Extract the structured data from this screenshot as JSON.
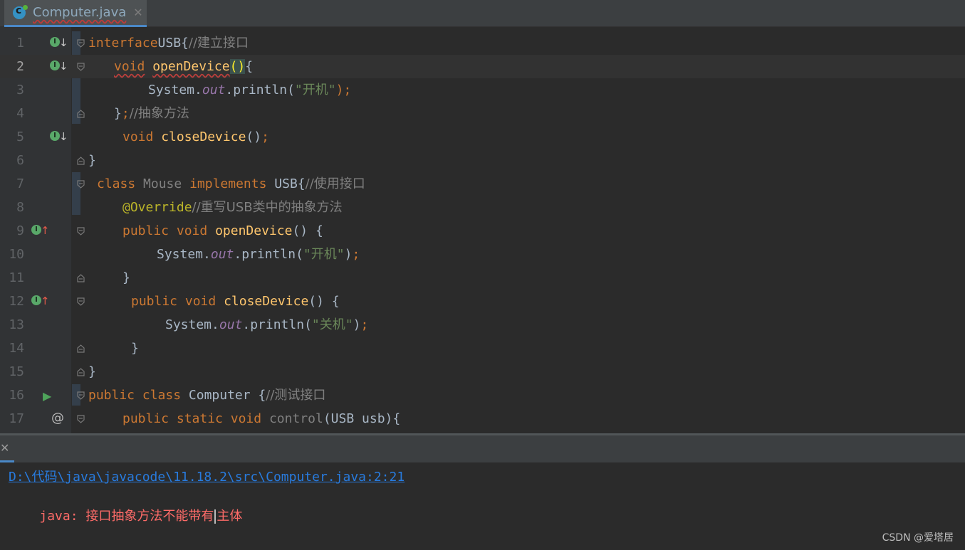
{
  "tab": {
    "filename": "Computer.java",
    "close_glyph": "✕"
  },
  "lines": [
    {
      "n": "1",
      "gutter": "impl-down",
      "fold": "open",
      "indent": 0,
      "tokens": [
        [
          "kw",
          "interface"
        ],
        [
          "",
          "USB{"
        ],
        [
          "cm",
          "//建立接口"
        ]
      ]
    },
    {
      "n": "2",
      "gutter": "impl-down",
      "fold": "open",
      "indent": 3,
      "current": true,
      "tokens": [
        [
          "kw squig",
          "void"
        ],
        [
          "",
          "·"
        ],
        [
          "fn squig",
          "openDevice"
        ],
        [
          "brk",
          "()"
        ],
        [
          "",
          "{"
        ]
      ]
    },
    {
      "n": "3",
      "gutter": "",
      "fold": "",
      "indent": 7,
      "tokens": [
        [
          "",
          "System."
        ],
        [
          "fld",
          "out"
        ],
        [
          "",
          ".println("
        ],
        [
          "str",
          "\"开机\""
        ],
        [
          "kw",
          ")"
        ],
        [
          "kw",
          ";"
        ]
      ]
    },
    {
      "n": "4",
      "gutter": "",
      "fold": "close",
      "indent": 3,
      "tokens": [
        [
          "",
          "}"
        ],
        [
          "kw",
          ";"
        ],
        [
          "cm",
          "//抽象方法"
        ]
      ]
    },
    {
      "n": "5",
      "gutter": "impl-down",
      "fold": "",
      "indent": 4,
      "tokens": [
        [
          "kw",
          "void"
        ],
        [
          "",
          ""
        ],
        [
          "fn",
          "closeDevice"
        ],
        [
          "",
          "()"
        ],
        [
          "kw",
          ";"
        ]
      ]
    },
    {
      "n": "6",
      "gutter": "",
      "fold": "close",
      "indent": 0,
      "tokens": [
        [
          "",
          "}"
        ]
      ]
    },
    {
      "n": "7",
      "gutter": "",
      "fold": "open",
      "indent": 1,
      "tokens": [
        [
          "kw",
          "class"
        ],
        [
          "",
          ""
        ],
        [
          "gray",
          "Mouse"
        ],
        [
          "",
          ""
        ],
        [
          "kw",
          "implements"
        ],
        [
          "",
          ""
        ],
        [
          "",
          "USB{"
        ],
        [
          "cm",
          "//使用接口"
        ]
      ]
    },
    {
      "n": "8",
      "gutter": "",
      "fold": "",
      "indent": 4,
      "tokens": [
        [
          "ann",
          "@Override"
        ],
        [
          "cm",
          "//重写USB类中的抽象方法"
        ]
      ]
    },
    {
      "n": "9",
      "gutter": "impl-up",
      "fold": "open",
      "indent": 4,
      "tokens": [
        [
          "kw",
          "public"
        ],
        [
          "",
          ""
        ],
        [
          "kw",
          "void"
        ],
        [
          "",
          ""
        ],
        [
          "fn",
          "openDevice"
        ],
        [
          "",
          "()"
        ],
        [
          "",
          ""
        ],
        [
          "",
          "{"
        ]
      ]
    },
    {
      "n": "10",
      "gutter": "",
      "fold": "",
      "indent": 8,
      "tokens": [
        [
          "",
          "System."
        ],
        [
          "fld",
          "out"
        ],
        [
          "",
          ".println("
        ],
        [
          "str",
          "\"开机\""
        ],
        [
          "",
          ")"
        ],
        [
          "kw",
          ";"
        ]
      ]
    },
    {
      "n": "11",
      "gutter": "",
      "fold": "close",
      "indent": 4,
      "tokens": [
        [
          "",
          "}"
        ]
      ]
    },
    {
      "n": "12",
      "gutter": "impl-up",
      "fold": "open",
      "indent": 5,
      "tokens": [
        [
          "kw",
          "public"
        ],
        [
          "",
          ""
        ],
        [
          "kw",
          "void"
        ],
        [
          "",
          ""
        ],
        [
          "fn",
          "closeDevice"
        ],
        [
          "",
          "()"
        ],
        [
          "",
          ""
        ],
        [
          "",
          "{"
        ]
      ]
    },
    {
      "n": "13",
      "gutter": "",
      "fold": "",
      "indent": 9,
      "tokens": [
        [
          "",
          "System."
        ],
        [
          "fld",
          "out"
        ],
        [
          "",
          ".println("
        ],
        [
          "str",
          "\"关机\""
        ],
        [
          "",
          ")"
        ],
        [
          "kw",
          ";"
        ]
      ]
    },
    {
      "n": "14",
      "gutter": "",
      "fold": "close",
      "indent": 5,
      "tokens": [
        [
          "",
          "}"
        ]
      ]
    },
    {
      "n": "15",
      "gutter": "",
      "fold": "close",
      "indent": 0,
      "tokens": [
        [
          "",
          "}"
        ]
      ]
    },
    {
      "n": "16",
      "gutter": "run",
      "fold": "open",
      "indent": 0,
      "tokens": [
        [
          "kw",
          "public"
        ],
        [
          "",
          ""
        ],
        [
          "kw",
          "class"
        ],
        [
          "",
          ""
        ],
        [
          "",
          "Computer"
        ],
        [
          "",
          ""
        ],
        [
          "",
          "{"
        ],
        [
          "cm",
          "//测试接口"
        ]
      ]
    },
    {
      "n": "17",
      "gutter": "at",
      "fold": "open",
      "indent": 4,
      "tokens": [
        [
          "kw",
          "public"
        ],
        [
          "",
          ""
        ],
        [
          "kw",
          "static"
        ],
        [
          "",
          ""
        ],
        [
          "kw",
          "void"
        ],
        [
          "",
          ""
        ],
        [
          "gray",
          "control"
        ],
        [
          "",
          "(USB"
        ],
        [
          "",
          ""
        ],
        [
          "",
          "usb){"
        ]
      ]
    }
  ],
  "output": {
    "path": "D:\\代码\\java\\javacode\\11.18.2\\src\\Computer.java:2:21",
    "label": "java:",
    "message_before_caret": "接口抽象方法不能带有",
    "message_after_caret": "主体"
  },
  "watermark": "CSDN @爱塔居",
  "colors": {
    "keyword": "#cc7832",
    "function": "#ffc66d",
    "string": "#6a8759",
    "comment": "#808080",
    "error": "#ff6b68",
    "link": "#287bde"
  }
}
